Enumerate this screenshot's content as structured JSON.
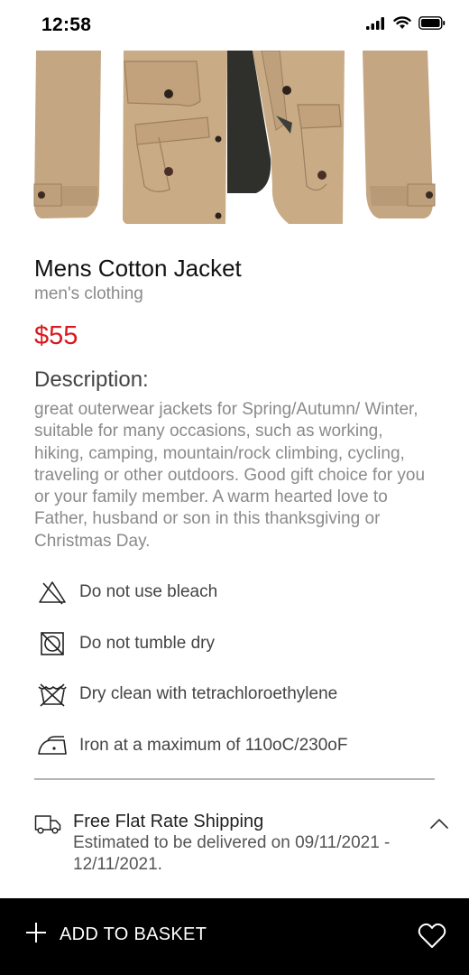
{
  "status_bar": {
    "time": "12:58",
    "icons": [
      "signal-icon",
      "wifi-icon",
      "battery-icon"
    ]
  },
  "product": {
    "image_name": "jacket-image",
    "title": "Mens Cotton Jacket",
    "category": "men's clothing",
    "price": "$55",
    "price_color": "#d9191e",
    "description_heading": "Description:",
    "description": "great outerwear jackets for Spring/Autumn/ Winter, suitable for many occasions, such as working, hiking, camping, mountain/rock climbing, cycling, traveling or other outdoors. Good gift choice for you or your family member. A warm hearted love to Father, husband or son in this thanksgiving or Christmas Day."
  },
  "care": [
    {
      "icon": "no-bleach-icon",
      "label": "Do not use bleach"
    },
    {
      "icon": "no-tumble-dry-icon",
      "label": "Do not tumble dry"
    },
    {
      "icon": "dry-clean-icon",
      "label": "Dry clean with tetrachloroethylene"
    },
    {
      "icon": "iron-icon",
      "label": "Iron at a maximum of 110oC/230oF"
    }
  ],
  "shipping": {
    "icon": "truck-icon",
    "title": "Free Flat Rate Shipping",
    "detail": "Estimated to be delivered on 09/11/2021 - 12/11/2021.",
    "toggle_icon": "chevron-up-icon"
  },
  "bottom_bar": {
    "add_icon": "plus-icon",
    "add_label": "ADD TO BASKET",
    "wishlist_icon": "heart-icon",
    "background": "#000000"
  }
}
